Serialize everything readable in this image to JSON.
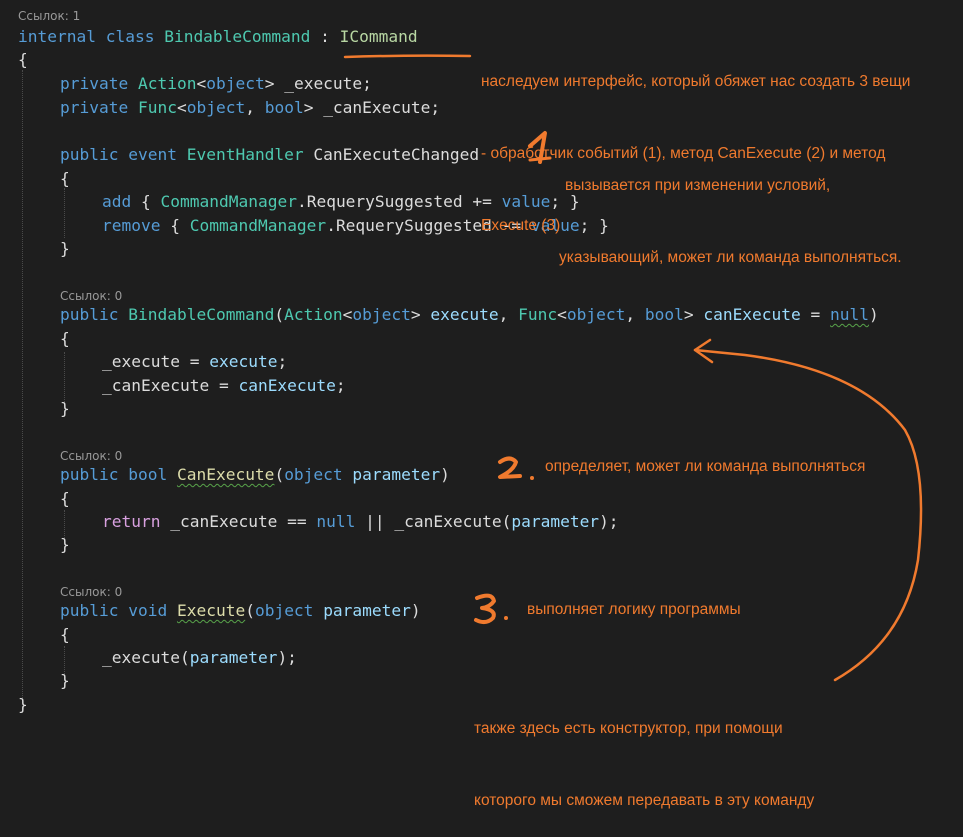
{
  "editor": {
    "refs": [
      "Ссылок: 1",
      "Ссылок: 0",
      "Ссылок: 0",
      "Ссылок: 0"
    ],
    "class_line": {
      "kw1": "internal",
      "kw2": "class",
      "name": "BindableCommand",
      "colon": " : ",
      "iface": "ICommand"
    },
    "brace_open": "{",
    "brace_close": "}",
    "field1": {
      "mod": "private",
      "type": "Action",
      "lt": "<",
      "arg": "object",
      "gt": "> ",
      "name": "_execute",
      "end": ";"
    },
    "field2": {
      "mod": "private",
      "type": "Func",
      "lt": "<",
      "arg1": "object",
      "sep": ", ",
      "arg2": "bool",
      "gt": "> ",
      "name": "_canExecute",
      "end": ";"
    },
    "event_line": {
      "mod": "public",
      "kw": "event",
      "type": "EventHandler",
      "name": "CanExecuteChanged"
    },
    "add_line": {
      "kw": "add",
      "open": " { ",
      "cls": "CommandManager",
      "dot": ".",
      "member": "RequerySuggested",
      "op": " += ",
      "val": "value",
      "close": "; }"
    },
    "remove_line": {
      "kw": "remove",
      "open": " { ",
      "cls": "CommandManager",
      "dot": ".",
      "member": "RequerySuggested",
      "op": " -= ",
      "val": "value",
      "close": "; }"
    },
    "ctor_line": {
      "mod": "public",
      "name": "BindableCommand",
      "p1": "(",
      "t1": "Action",
      "lt1": "<",
      "a1": "object",
      "gt1": "> ",
      "n1": "execute",
      "sep": ", ",
      "t2": "Func",
      "lt2": "<",
      "a2": "object",
      "c2": ", ",
      "a3": "bool",
      "gt2": "> ",
      "n2": "canExecute",
      "eq": " = ",
      "nul": "null",
      "close": ")"
    },
    "assign1": {
      "field": "_execute",
      "op": " = ",
      "val": "execute",
      "end": ";"
    },
    "assign2": {
      "field": "_canExecute",
      "op": " = ",
      "val": "canExecute",
      "end": ";"
    },
    "canexec_line": {
      "mod": "public",
      "type": "bool",
      "name": "CanExecute",
      "open": "(",
      "ptype": "object",
      "pname": "parameter",
      "close": ")"
    },
    "return_line": {
      "kw": "return",
      "f": " _canExecute",
      "op": " == ",
      "nul": "null",
      "or": " || ",
      "call": "_canExecute",
      "open": "(",
      "arg": "parameter",
      "close": ");"
    },
    "exec_line": {
      "mod": "public",
      "type": "void",
      "name": "Execute",
      "open": "(",
      "ptype": "object",
      "pname": "parameter",
      "close": ")"
    },
    "exec_body": {
      "call": "_execute",
      "open": "(",
      "arg": "parameter",
      "close": ");"
    }
  },
  "notes": {
    "iface": [
      "наследуем интерфейс, который обяжет нас создать 3 вещи",
      "- обработчик событий (1), метод CanExecute (2) и метод",
      "Execute (3)"
    ],
    "n1": [
      "вызывается при изменении условий,",
      "указывающий, может ли команда выполняться."
    ],
    "n2": "определяет, может ли команда выполняться",
    "n3": "выполняет логику программы",
    "ctor": [
      "также здесь есть конструктор, при помощи",
      "которого мы сможем передавать в эту команду"
    ],
    "num1": "1",
    "num2": "2.",
    "num3": "3."
  },
  "colors": {
    "background": "#1e1e1e",
    "annotation": "#f07a2e",
    "keyword": "#569cd6",
    "type": "#4ec9b0",
    "method": "#dcdcaa",
    "parameter": "#9cdcfe"
  }
}
